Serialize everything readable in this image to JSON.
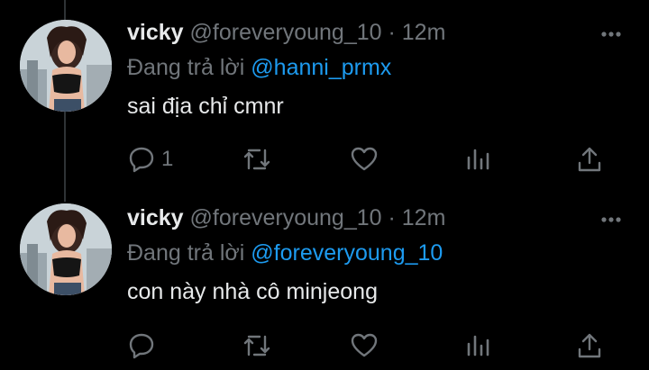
{
  "tweets": [
    {
      "name": "vicky",
      "handle": "@foreveryoung_10",
      "separator": "·",
      "time": "12m",
      "reply_prefix": "Đang trả lời",
      "reply_to": "@hanni_prmx",
      "text": "sai địa chỉ cmnr",
      "reply_count": "1"
    },
    {
      "name": "vicky",
      "handle": "@foreveryoung_10",
      "separator": "·",
      "time": "12m",
      "reply_prefix": "Đang trả lời",
      "reply_to": "@foreveryoung_10",
      "text": "con này nhà cô minjeong",
      "reply_count": ""
    }
  ],
  "icons": [
    "more-icon",
    "reply-icon",
    "retweet-icon",
    "like-icon",
    "analytics-icon",
    "share-icon"
  ],
  "colors": {
    "background": "#000000",
    "text": "#e7e9ea",
    "muted": "#71767b",
    "accent": "#1d9bf0",
    "thread_line": "#2f3336"
  }
}
